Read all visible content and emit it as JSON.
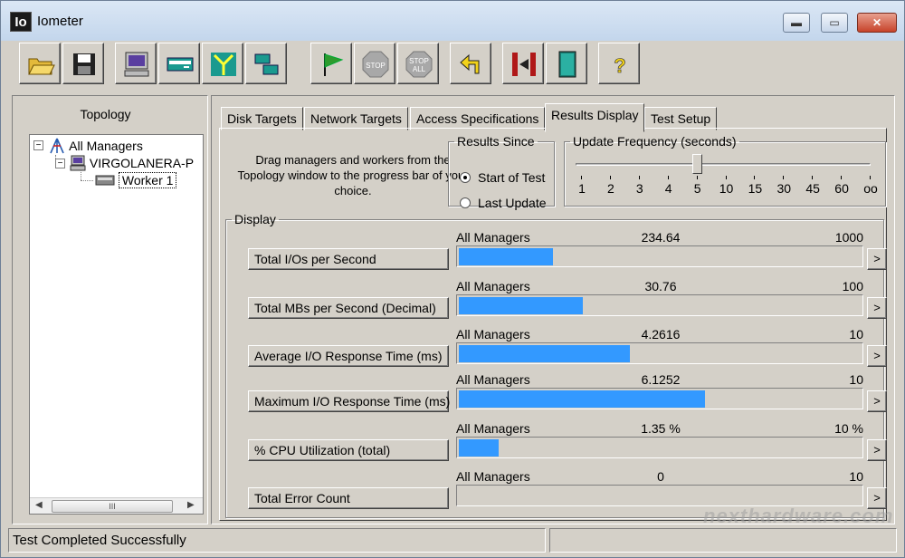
{
  "window": {
    "title": "Iometer",
    "app_icon_text": "Io",
    "controls": {
      "minimize": "▬",
      "maximize": "▭",
      "close": "✕"
    }
  },
  "toolbar": {
    "buttons": [
      {
        "name": "open-config-icon"
      },
      {
        "name": "save-config-icon"
      },
      {
        "name": "new-disk-worker-icon"
      },
      {
        "name": "new-network-worker-icon"
      },
      {
        "name": "duplicate-worker-icon"
      },
      {
        "name": "disconnect-icon"
      },
      {
        "name": "start-tests-icon"
      },
      {
        "name": "stop-icon",
        "label": "STOP"
      },
      {
        "name": "stop-all-icon",
        "label": "STOP ALL"
      },
      {
        "name": "reset-workers-icon"
      },
      {
        "name": "start-managers-icon"
      },
      {
        "name": "exit-icon"
      },
      {
        "name": "help-icon",
        "label": "?"
      }
    ]
  },
  "topology": {
    "label": "Topology",
    "tree": {
      "root": "All Managers",
      "manager": "VIRGOLANERA-P",
      "worker": "Worker 1"
    },
    "scroll_grip": "III"
  },
  "tabs": [
    {
      "label": "Disk Targets"
    },
    {
      "label": "Network Targets"
    },
    {
      "label": "Access Specifications"
    },
    {
      "label": "Results Display",
      "active": true
    },
    {
      "label": "Test Setup"
    }
  ],
  "results": {
    "instructions": "Drag managers and workers from the Topology window to the progress bar of your choice.",
    "results_since": {
      "label": "Results Since",
      "options": [
        "Start of Test",
        "Last Update"
      ],
      "selected": "Start of Test"
    },
    "update_frequency": {
      "label": "Update Frequency (seconds)",
      "ticks": [
        "1",
        "2",
        "3",
        "4",
        "5",
        "10",
        "15",
        "30",
        "45",
        "60",
        "oo"
      ],
      "selected_index": 4
    },
    "display_label": "Display",
    "metrics": [
      {
        "button": "Total I/Os per Second",
        "manager": "All Managers",
        "value": "234.64",
        "max": "1000",
        "fraction": 0.2346
      },
      {
        "button": "Total MBs per Second (Decimal)",
        "manager": "All Managers",
        "value": "30.76",
        "max": "100",
        "fraction": 0.3076
      },
      {
        "button": "Average I/O Response Time (ms)",
        "manager": "All Managers",
        "value": "4.2616",
        "max": "10",
        "fraction": 0.4262
      },
      {
        "button": "Maximum I/O Response Time (ms)",
        "manager": "All Managers",
        "value": "6.1252",
        "max": "10",
        "fraction": 0.6125
      },
      {
        "button": "% CPU Utilization (total)",
        "manager": "All Managers",
        "value": "1.35 %",
        "max": "10 %",
        "fraction": 0.1
      },
      {
        "button": "Total Error Count",
        "manager": "All Managers",
        "value": "0",
        "max": "10",
        "fraction": 0
      }
    ],
    "row_arrow": ">"
  },
  "status": {
    "text": "Test Completed Successfully"
  },
  "watermark": "nexthardware.com",
  "colors": {
    "bar": "#3399ff",
    "face": "#d4d0c8"
  }
}
